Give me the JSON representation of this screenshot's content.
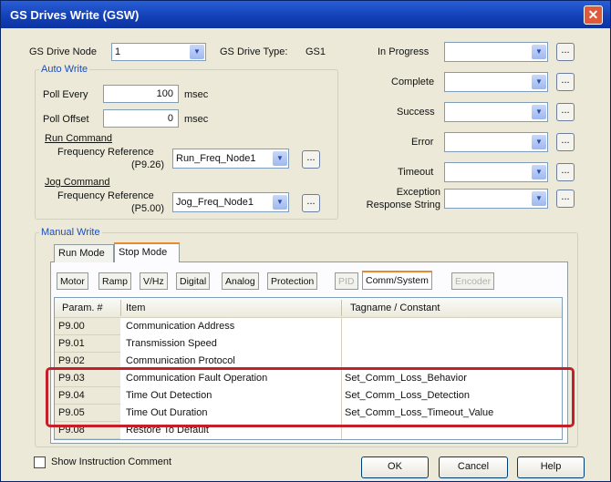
{
  "window": {
    "title": "GS Drives Write (GSW)"
  },
  "header": {
    "node_label": "GS Drive Node",
    "node_value": "1",
    "drive_type_label": "GS Drive Type:",
    "drive_type_value": "GS1"
  },
  "status_fields": [
    {
      "label": "In Progress"
    },
    {
      "label": "Complete"
    },
    {
      "label": "Success"
    },
    {
      "label": "Error"
    },
    {
      "label": "Timeout"
    },
    {
      "label": "Exception Response String"
    }
  ],
  "auto_write": {
    "title": "Auto Write",
    "poll_every_label": "Poll Every",
    "poll_every_value": "100",
    "poll_offset_label": "Poll Offset",
    "poll_offset_value": "0",
    "unit": "msec",
    "run_command_label": "Run Command",
    "run_freq_label": "Frequency Reference",
    "run_freq_param": "(P9.26)",
    "run_freq_value": "Run_Freq_Node1",
    "jog_command_label": "Jog Command",
    "jog_freq_label": "Frequency Reference",
    "jog_freq_param": "(P5.00)",
    "jog_freq_value": "Jog_Freq_Node1"
  },
  "manual_write": {
    "title": "Manual Write",
    "tabs": [
      "Run Mode",
      "Stop Mode"
    ],
    "subtabs": [
      "Motor",
      "Ramp",
      "V/Hz",
      "Digital",
      "Analog",
      "Protection",
      "PID",
      "Comm/System",
      "Encoder"
    ],
    "columns": [
      "Param. #",
      "Item",
      "Tagname / Constant"
    ],
    "rows": [
      {
        "param": "P9.00",
        "item": "Communication Address",
        "tag": ""
      },
      {
        "param": "P9.01",
        "item": "Transmission Speed",
        "tag": ""
      },
      {
        "param": "P9.02",
        "item": "Communication Protocol",
        "tag": ""
      },
      {
        "param": "P9.03",
        "item": "Communication Fault Operation",
        "tag": "Set_Comm_Loss_Behavior"
      },
      {
        "param": "P9.04",
        "item": "Time Out Detection",
        "tag": "Set_Comm_Loss_Detection"
      },
      {
        "param": "P9.05",
        "item": "Time Out Duration",
        "tag": "Set_Comm_Loss_Timeout_Value"
      },
      {
        "param": "P9.08",
        "item": "Restore To Default",
        "tag": ""
      }
    ]
  },
  "footer": {
    "show_comment_label": "Show Instruction Comment",
    "ok": "OK",
    "cancel": "Cancel",
    "help": "Help"
  },
  "ui": {
    "ellipsis": "...",
    "dropdown_glyph": "▼",
    "close_glyph": "✕"
  },
  "colors": {
    "titlebar": "#1241b8",
    "highlight": "#c3202a",
    "group_title": "#1a4ebf"
  }
}
